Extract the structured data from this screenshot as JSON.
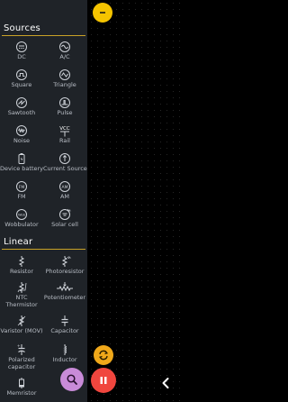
{
  "sections": {
    "sources": {
      "title": "Sources",
      "items": [
        {
          "label": "DC",
          "icon": "dc-source-icon"
        },
        {
          "label": "A/C",
          "icon": "ac-source-icon"
        },
        {
          "label": "Square",
          "icon": "square-wave-icon"
        },
        {
          "label": "Triangle",
          "icon": "triangle-wave-icon"
        },
        {
          "label": "Sawtooth",
          "icon": "sawtooth-wave-icon"
        },
        {
          "label": "Pulse",
          "icon": "pulse-icon"
        },
        {
          "label": "Noise",
          "icon": "noise-icon"
        },
        {
          "label": "Rail",
          "icon": "rail-icon",
          "icon_text": "VCC"
        },
        {
          "label": "Device battery",
          "icon": "battery-icon"
        },
        {
          "label": "Current Source",
          "icon": "current-source-icon"
        },
        {
          "label": "FM",
          "icon": "fm-source-icon"
        },
        {
          "label": "AM",
          "icon": "am-source-icon"
        },
        {
          "label": "Wobbulator",
          "icon": "wobbulator-icon"
        },
        {
          "label": "Solar cell",
          "icon": "solar-cell-icon"
        }
      ]
    },
    "linear": {
      "title": "Linear",
      "items": [
        {
          "label": "Resistor",
          "icon": "resistor-icon"
        },
        {
          "label": "Photoresistor",
          "icon": "photoresistor-icon"
        },
        {
          "label": "NTC",
          "label2": "Thermistor",
          "icon": "thermistor-icon"
        },
        {
          "label": "Potentiometer",
          "icon": "potentiometer-icon"
        },
        {
          "label": "Varistor (MOV)",
          "icon": "varistor-icon"
        },
        {
          "label": "Capacitor",
          "icon": "capacitor-icon"
        },
        {
          "label": "Polarized",
          "label2": "capacitor",
          "icon": "polarized-capacitor-icon"
        },
        {
          "label": "Inductor",
          "icon": "inductor-icon"
        },
        {
          "label": "Memristor",
          "icon": "memristor-icon"
        }
      ]
    }
  },
  "buttons": {
    "top_toggle": {
      "icon": "minus-icon"
    },
    "swap": {
      "icon": "swap-icon"
    },
    "search": {
      "icon": "search-icon"
    },
    "pause": {
      "icon": "pause-icon"
    },
    "back": {
      "icon": "chevron-left-icon"
    }
  },
  "colors": {
    "drawer_bg": "#1f2328",
    "accent_rule": "#c9a227",
    "yellow": "#f5c400",
    "orange": "#f0a81a",
    "purple": "#c98bd8",
    "red": "#f0463e"
  }
}
